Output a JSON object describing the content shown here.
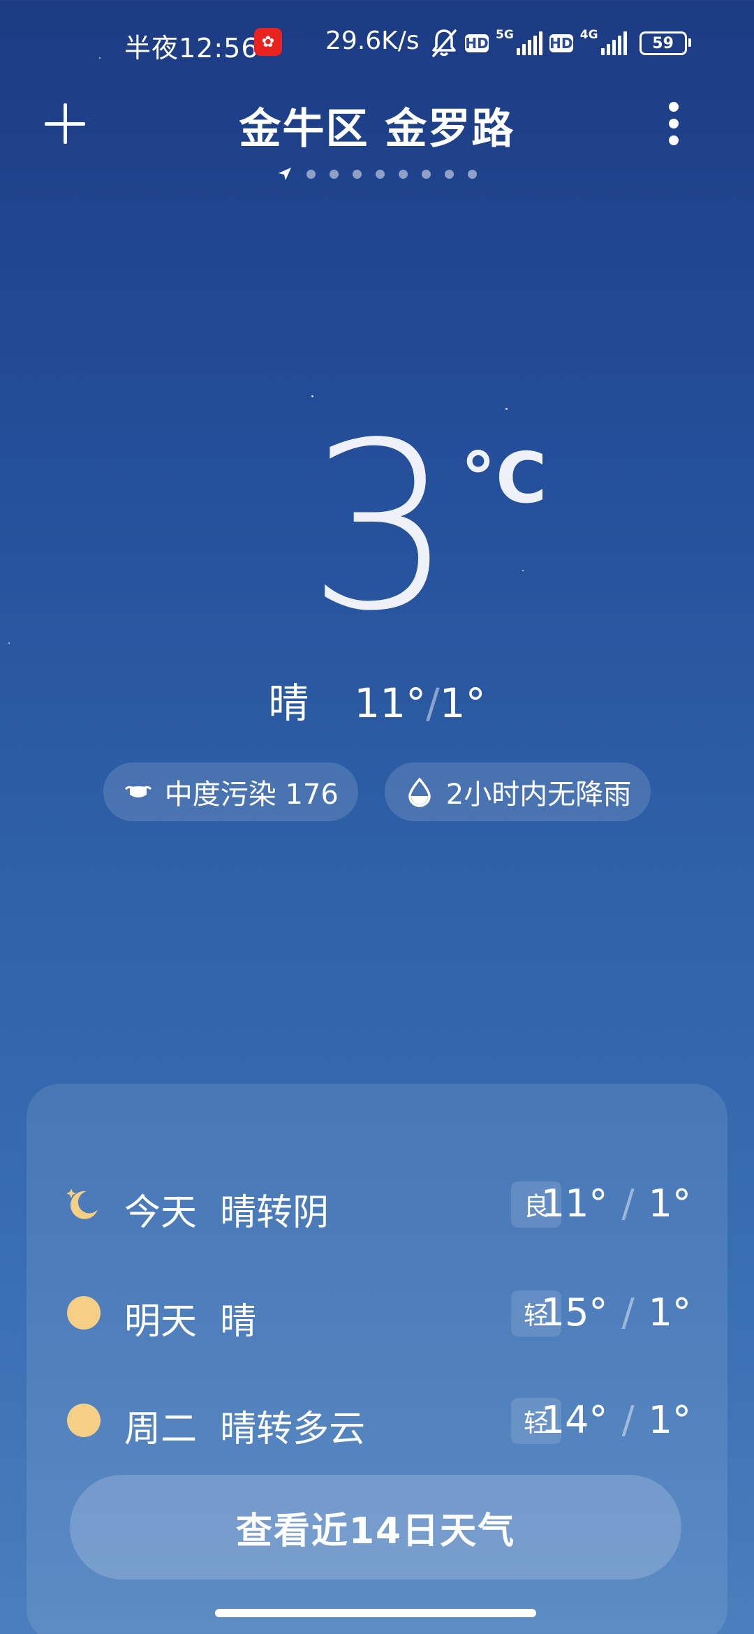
{
  "status_bar": {
    "time": "半夜12:56",
    "network_speed": "29.6K/s",
    "hd1": "HD",
    "net1": "5G",
    "hd2": "HD",
    "net2": "4G",
    "battery": "59",
    "icons": [
      "app-notification-icon",
      "bell-muted-icon",
      "signal-icon",
      "battery-icon"
    ]
  },
  "header": {
    "location": "金牛区 金罗路",
    "page_count": 9,
    "active_page": 0
  },
  "current": {
    "temperature": "3",
    "unit": "°C",
    "condition": "晴",
    "high": "11°",
    "low": "1°"
  },
  "chips": {
    "aqi_label": "中度污染 176",
    "rain_label": "2小时内无降雨"
  },
  "forecast": [
    {
      "icon": "moon-icon",
      "day": "今天",
      "condition": "晴转阴",
      "aqi": "良",
      "high": "11°",
      "low": "1°"
    },
    {
      "icon": "sun-icon",
      "day": "明天",
      "condition": "晴",
      "aqi": "轻",
      "high": "15°",
      "low": "1°"
    },
    {
      "icon": "sun-icon",
      "day": "周二",
      "condition": "晴转多云",
      "aqi": "轻",
      "high": "14°",
      "low": "1°"
    }
  ],
  "more_button": "查看近14日天气",
  "colors": {
    "bg_top": "#1c3b83",
    "bg_bottom": "#4a7fbd",
    "sun": "#f6cf86"
  }
}
